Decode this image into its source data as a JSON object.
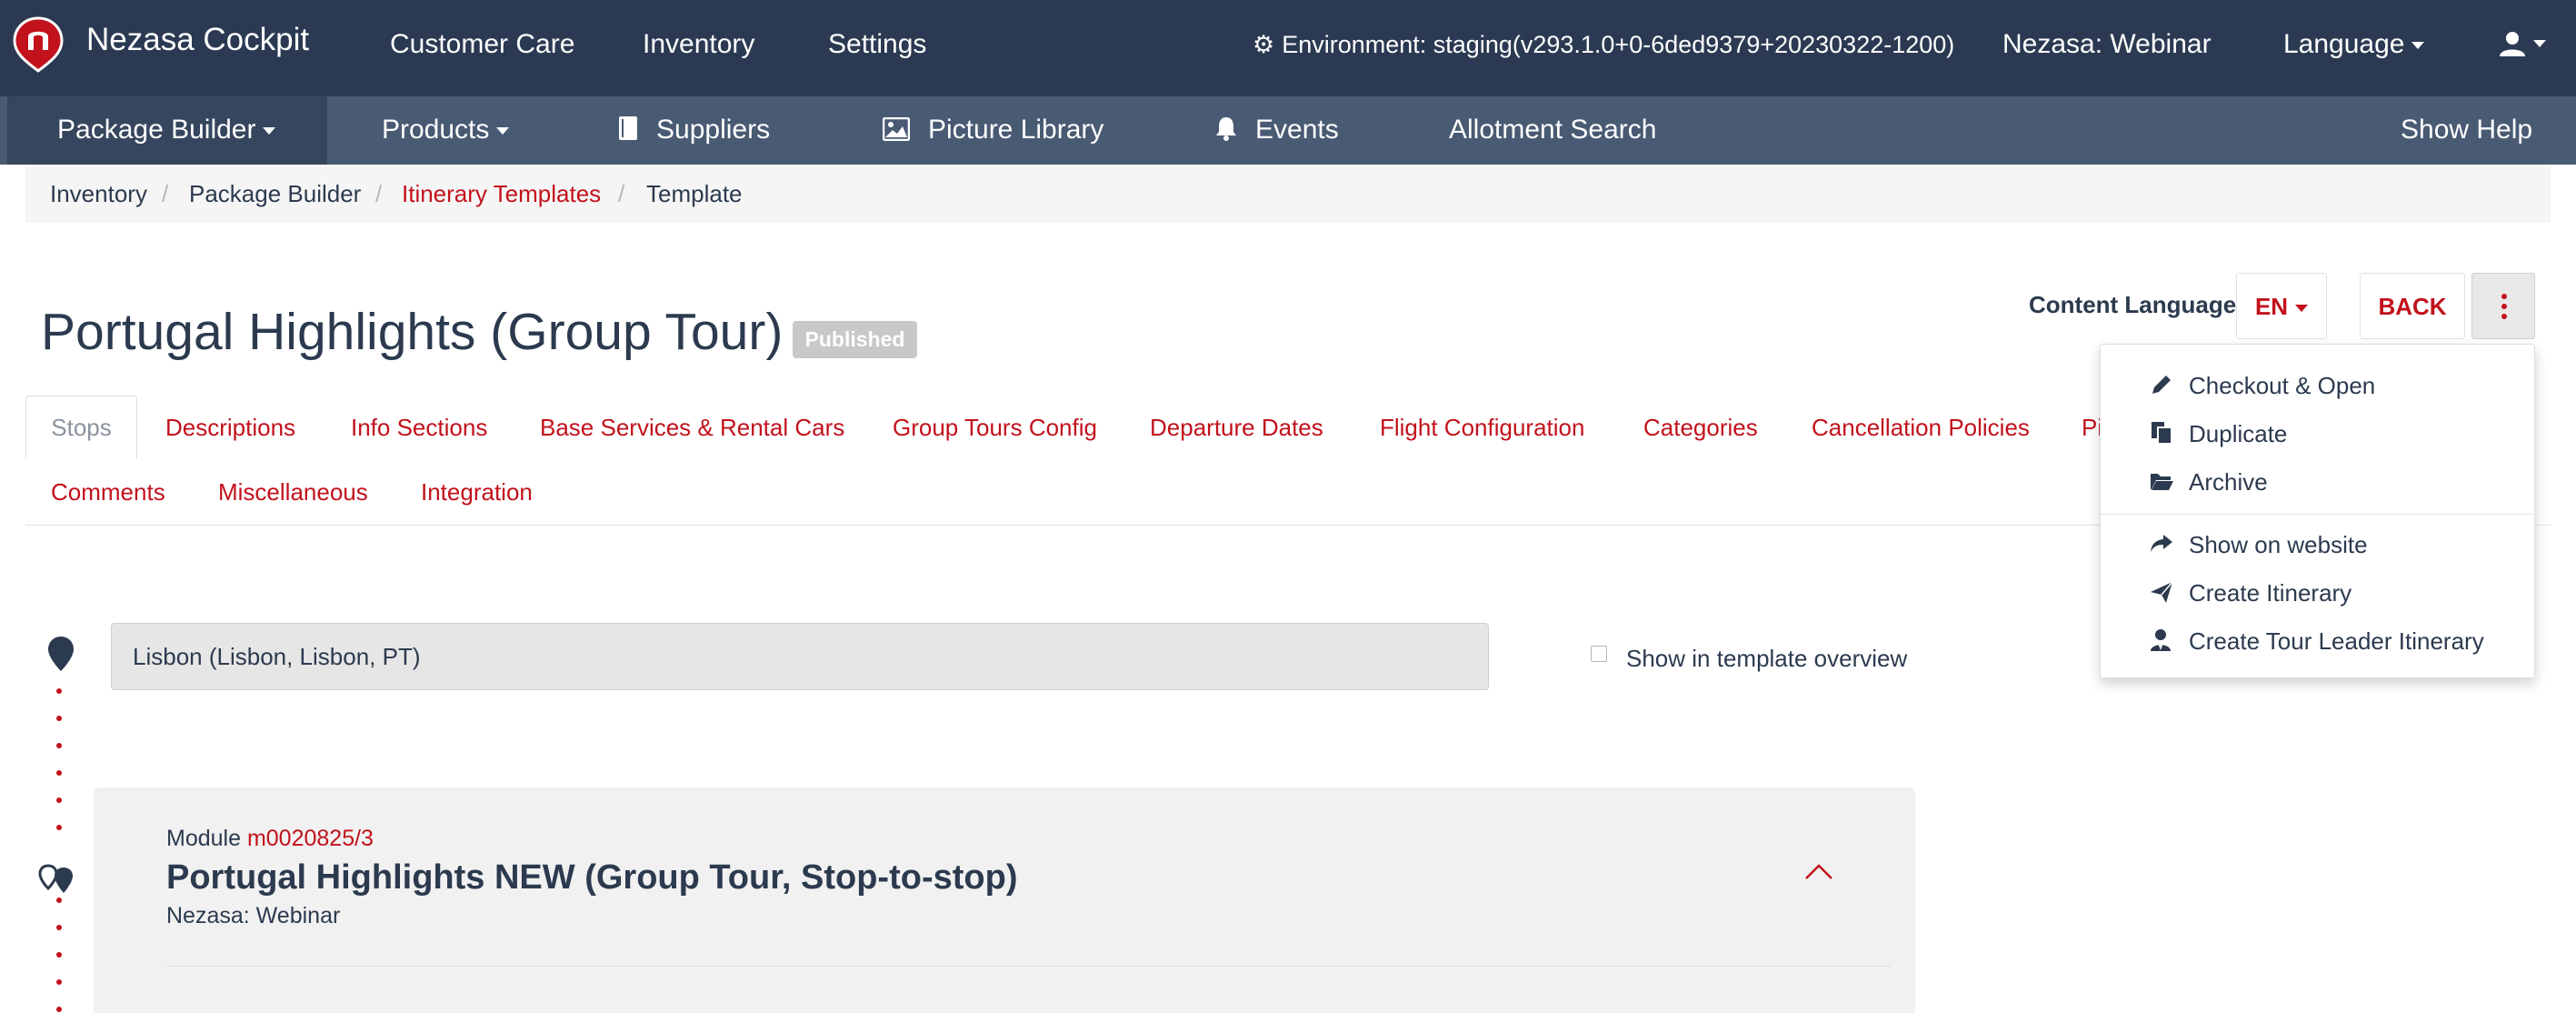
{
  "topbar": {
    "brand": "Nezasa Cockpit",
    "nav": [
      "Customer Care",
      "Inventory",
      "Settings"
    ],
    "environment": "Environment: staging(v293.1.0+0-6ded9379+20230322-1200)",
    "workspace": "Nezasa: Webinar",
    "language": "Language"
  },
  "subnav": {
    "package_builder": "Package Builder",
    "products": "Products",
    "suppliers": "Suppliers",
    "picture_library": "Picture Library",
    "events": "Events",
    "allotment_search": "Allotment Search",
    "show_help": "Show Help"
  },
  "breadcrumb": [
    "Inventory",
    "Package Builder",
    "Itinerary Templates",
    "Template"
  ],
  "page": {
    "title": "Portugal Highlights (Group Tour)",
    "status": "Published",
    "content_language_label": "Content Language",
    "content_language_value": "EN",
    "back_label": "BACK"
  },
  "tabs": {
    "active": "Stops",
    "row1": [
      "Descriptions",
      "Info Sections",
      "Base Services & Rental Cars",
      "Group Tours Config",
      "Departure Dates",
      "Flight Configuration",
      "Categories",
      "Cancellation Policies",
      "Pi"
    ],
    "row2": [
      "Comments",
      "Miscellaneous",
      "Integration"
    ]
  },
  "menu": {
    "group1": [
      "Checkout & Open",
      "Duplicate",
      "Archive"
    ],
    "group2": [
      "Show on website",
      "Create Itinerary",
      "Create Tour Leader Itinerary"
    ]
  },
  "stop": {
    "value": "Lisbon (Lisbon, Lisbon, PT)",
    "show_in_overview_label": "Show in template overview"
  },
  "module": {
    "prefix": "Module",
    "id": "m0020825/3",
    "title": "Portugal Highlights NEW (Group Tour, Stop-to-stop)",
    "owner": "Nezasa: Webinar"
  },
  "colors": {
    "navbar": "#2b3a52",
    "subnav": "#495a73",
    "accent": "#c2121c",
    "text": "#2c3a4f"
  }
}
